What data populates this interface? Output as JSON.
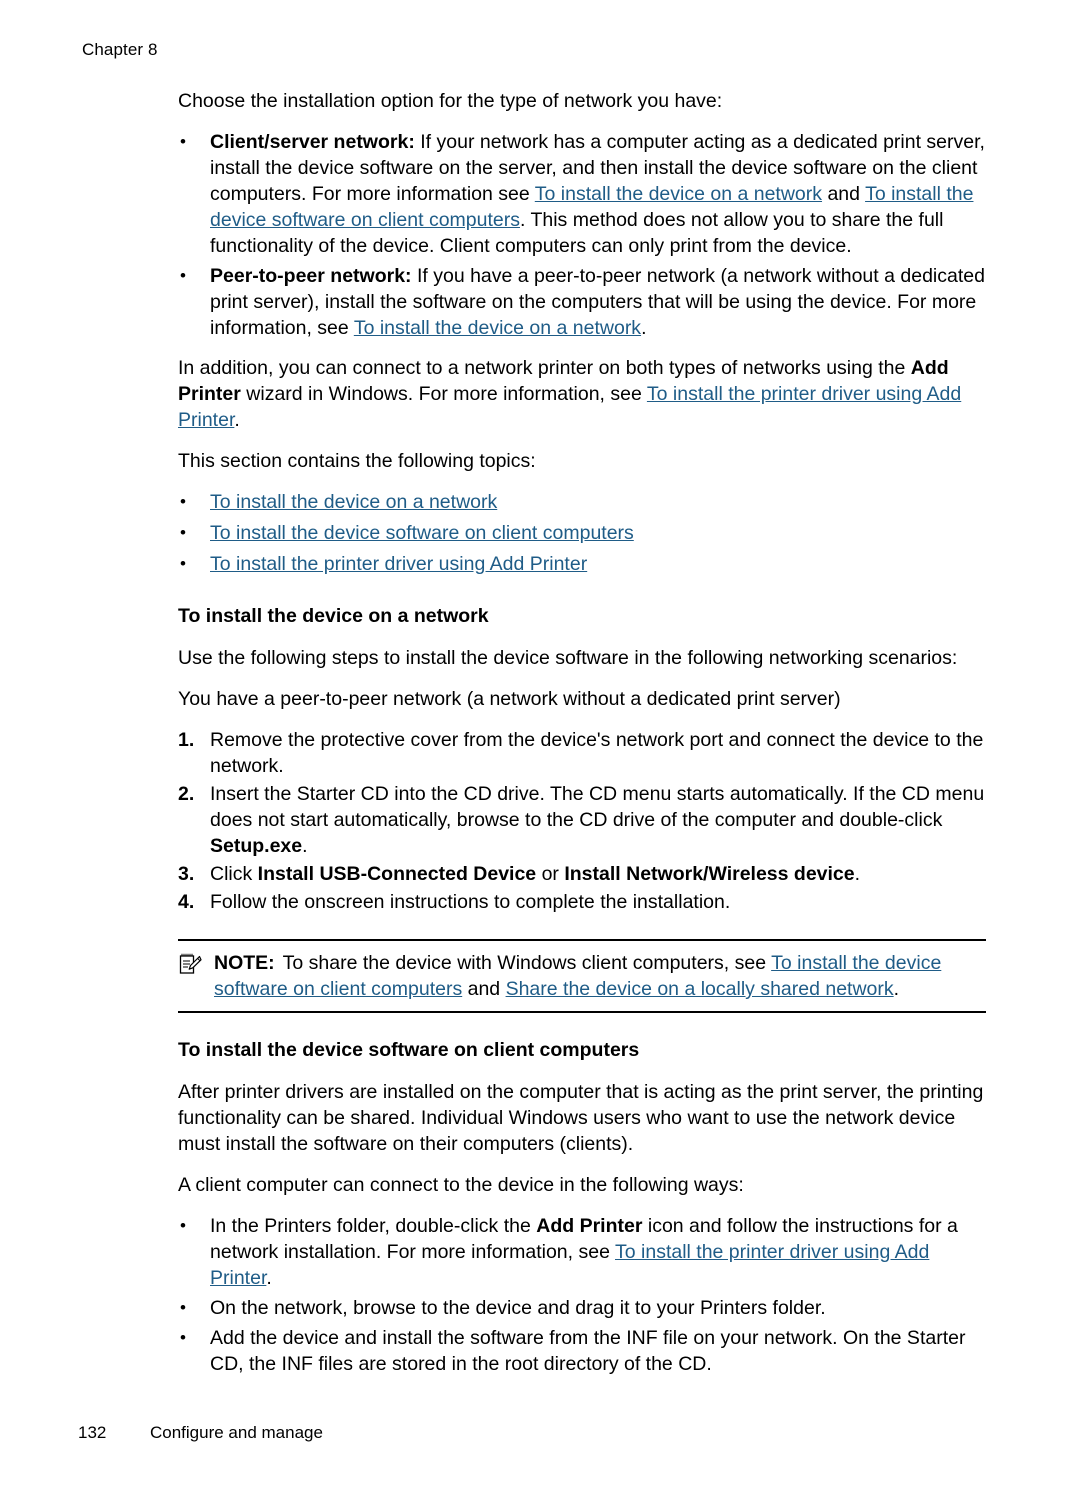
{
  "header": {
    "chapter": "Chapter 8"
  },
  "intro": {
    "lead": "Choose the installation option for the type of network you have:"
  },
  "network_types": [
    {
      "term": "Client/server network:",
      "text_1": " If your network has a computer acting as a dedicated print server, install the device software on the server, and then install the device software on the client computers. For more information see ",
      "link_1": "To install the device on a network",
      "text_2": " and ",
      "link_2": "To install the device software on client computers",
      "text_3": ". This method does not allow you to share the full functionality of the device. Client computers can only print from the device."
    },
    {
      "term": "Peer-to-peer network:",
      "text_1": " If you have a peer-to-peer network (a network without a dedicated print server), install the software on the computers that will be using the device. For more information, see ",
      "link_1": "To install the device on a network",
      "text_2": ".",
      "link_2": "",
      "text_3": ""
    }
  ],
  "addition_para": {
    "text_1": "In addition, you can connect to a network printer on both types of networks using the ",
    "bold_1": "Add Printer",
    "text_2": " wizard in Windows. For more information, see ",
    "link_1": "To install the printer driver using Add Printer",
    "text_3": "."
  },
  "topics_intro": "This section contains the following topics:",
  "topic_links": [
    "To install the device on a network",
    "To install the device software on client computers",
    "To install the printer driver using Add Printer"
  ],
  "section_network": {
    "heading": "To install the device on a network",
    "para_1": "Use the following steps to install the device software in the following networking scenarios:",
    "para_2": "You have a peer-to-peer network (a network without a dedicated print server)",
    "steps": [
      {
        "num": "1.",
        "text_1": "Remove the protective cover from the device's network port and connect the device to the network.",
        "bold_1": "",
        "text_2": "",
        "bold_2": "",
        "text_3": ""
      },
      {
        "num": "2.",
        "text_1": "Insert the Starter CD into the CD drive. The CD menu starts automatically. If the CD menu does not start automatically, browse to the CD drive of the computer and double-click ",
        "bold_1": "Setup.exe",
        "text_2": ".",
        "bold_2": "",
        "text_3": ""
      },
      {
        "num": "3.",
        "text_1": "Click ",
        "bold_1": "Install USB-Connected Device",
        "text_2": " or ",
        "bold_2": "Install Network/Wireless device",
        "text_3": "."
      },
      {
        "num": "4.",
        "text_1": "Follow the onscreen instructions to complete the installation.",
        "bold_1": "",
        "text_2": "",
        "bold_2": "",
        "text_3": ""
      }
    ]
  },
  "note": {
    "icon": "note-memo-icon",
    "label": "NOTE:",
    "text_1": "To share the device with Windows client computers, see ",
    "link_1": "To install the device software on client computers",
    "text_2": " and ",
    "link_2": "Share the device on a locally shared network",
    "text_3": "."
  },
  "section_client": {
    "heading": "To install the device software on client computers",
    "para_1": "After printer drivers are installed on the computer that is acting as the print server, the printing functionality can be shared. Individual Windows users who want to use the network device must install the software on their computers (clients).",
    "para_2": "A client computer can connect to the device in the following ways:",
    "bullets": [
      {
        "text_1": "In the Printers folder, double-click the ",
        "bold_1": "Add Printer",
        "text_2": " icon and follow the instructions for a network installation. For more information, see ",
        "link_1": "To install the printer driver using Add Printer",
        "text_3": "."
      },
      {
        "text_1": "On the network, browse to the device and drag it to your Printers folder.",
        "bold_1": "",
        "text_2": "",
        "link_1": "",
        "text_3": ""
      },
      {
        "text_1": "Add the device and install the software from the INF file on your network. On the Starter CD, the INF files are stored in the root directory of the CD.",
        "bold_1": "",
        "text_2": "",
        "link_1": "",
        "text_3": ""
      }
    ]
  },
  "footer": {
    "page_number": "132",
    "section_title": "Configure and manage"
  },
  "colors": {
    "link": "#1f5c87",
    "text": "#000000",
    "background": "#ffffff"
  },
  "bullet_glyph": "•"
}
